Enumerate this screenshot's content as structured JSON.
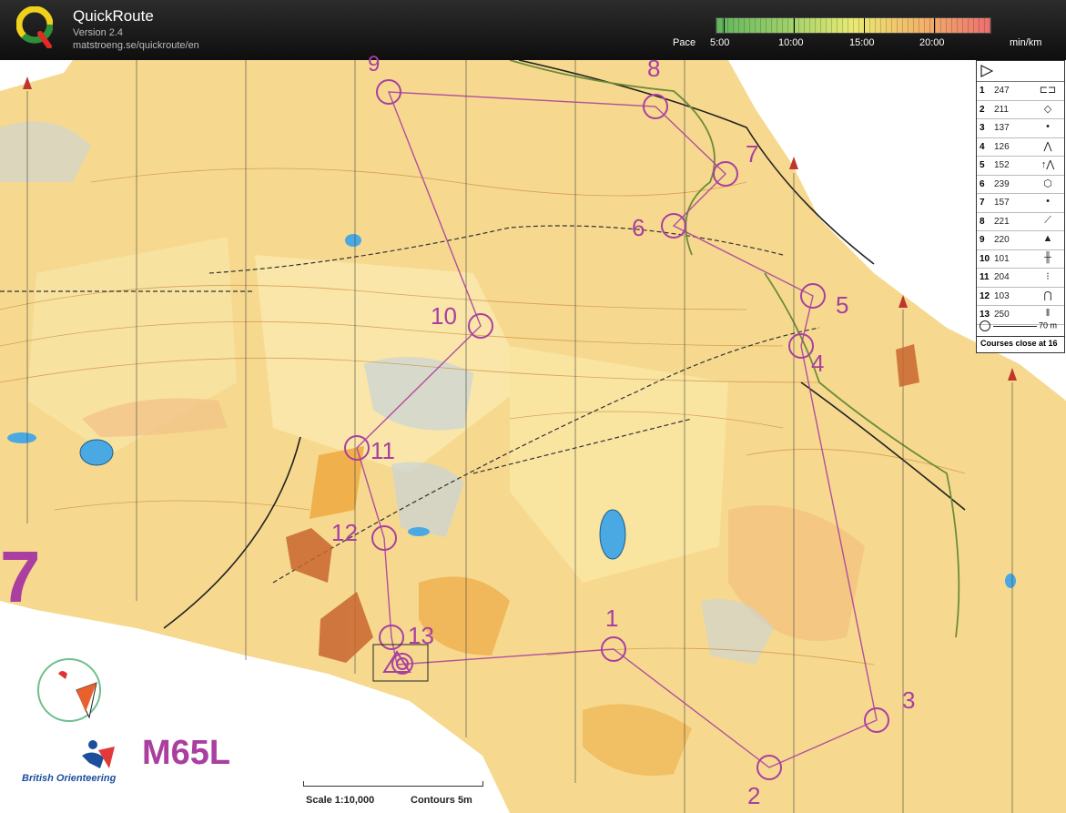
{
  "app": {
    "title": "QuickRoute",
    "version": "Version 2.4",
    "url": "matstroeng.se/quickroute/en"
  },
  "pace_scale": {
    "label": "Pace",
    "unit": "min/km",
    "ticks": [
      "5:00",
      "10:00",
      "15:00",
      "20:00"
    ],
    "colors": {
      "slow": "#eb6f6f",
      "medium": "#e9ea73",
      "fast": "#61b55e"
    }
  },
  "map": {
    "course_name": "M65L",
    "big_number": "7",
    "scale_text": "Scale 1:10,000",
    "contours_text": "Contours 5m",
    "organisation": "British Orienteering",
    "course_color": "#aa3fa0",
    "terrain_color": "#f6d98e"
  },
  "control_descriptions": {
    "rows": [
      {
        "num": "1",
        "code": "247"
      },
      {
        "num": "2",
        "code": "211"
      },
      {
        "num": "3",
        "code": "137"
      },
      {
        "num": "4",
        "code": "126"
      },
      {
        "num": "5",
        "code": "152"
      },
      {
        "num": "6",
        "code": "239"
      },
      {
        "num": "7",
        "code": "157"
      },
      {
        "num": "8",
        "code": "221"
      },
      {
        "num": "9",
        "code": "220"
      },
      {
        "num": "10",
        "code": "101"
      },
      {
        "num": "11",
        "code": "204"
      },
      {
        "num": "12",
        "code": "103"
      },
      {
        "num": "13",
        "code": "250"
      }
    ],
    "scale_label": "70 m",
    "footer": "Courses close at 16"
  },
  "controls": [
    {
      "label": "1"
    },
    {
      "label": "2"
    },
    {
      "label": "3"
    },
    {
      "label": "4"
    },
    {
      "label": "5"
    },
    {
      "label": "6"
    },
    {
      "label": "7"
    },
    {
      "label": "8"
    },
    {
      "label": "9"
    },
    {
      "label": "10"
    },
    {
      "label": "11"
    },
    {
      "label": "12"
    },
    {
      "label": "13"
    }
  ]
}
